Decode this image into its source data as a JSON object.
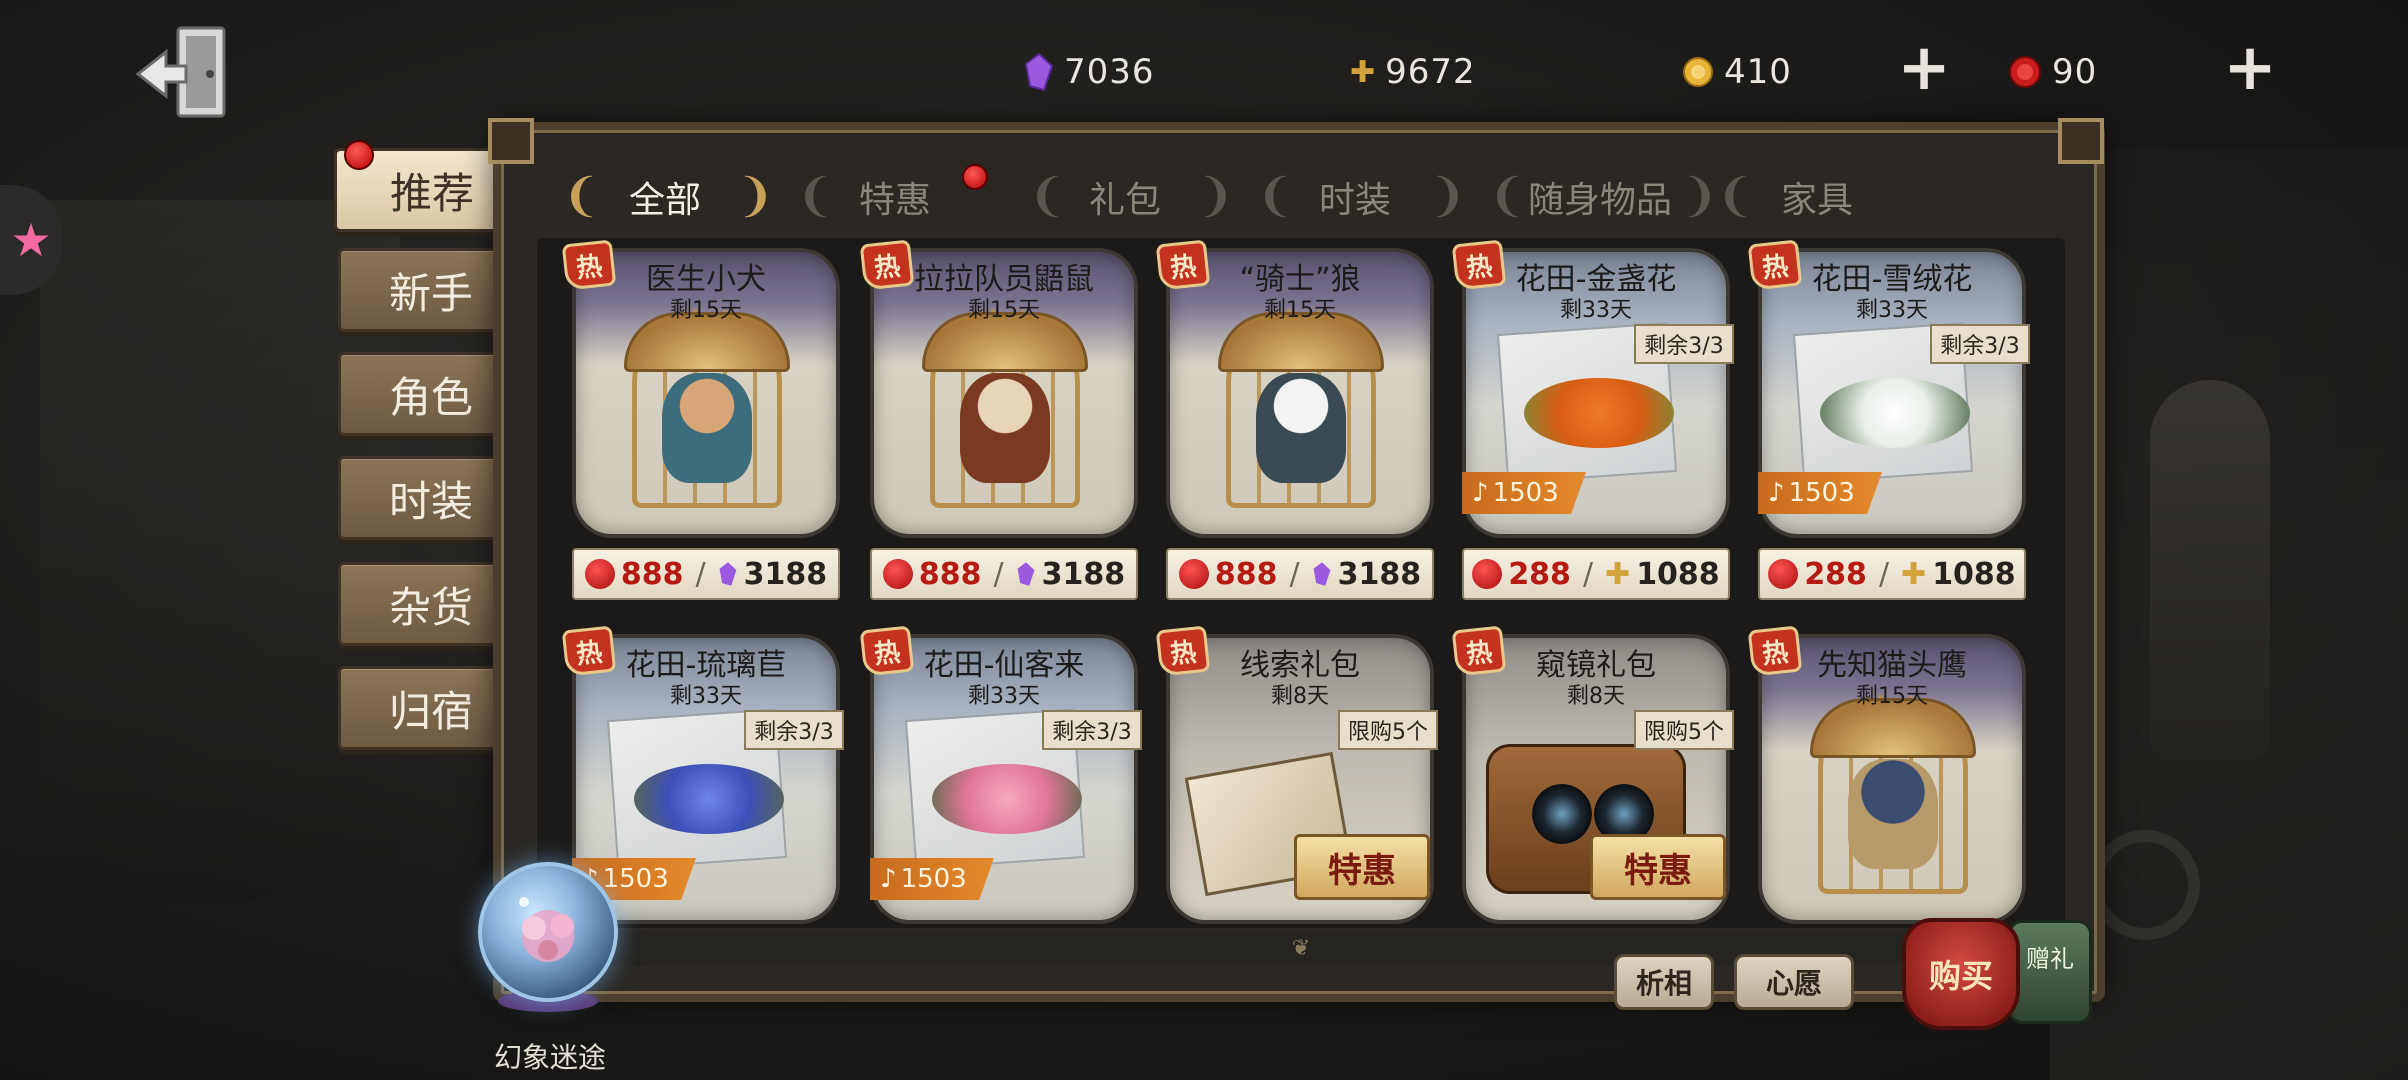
{
  "currencies": [
    {
      "icon": "purple-gem-icon",
      "value": "7036"
    },
    {
      "icon": "puzzle-piece-icon",
      "value": "9672"
    },
    {
      "icon": "gold-coin-icon",
      "value": "410"
    },
    {
      "icon": "red-seal-icon",
      "value": "90"
    }
  ],
  "sidebar": {
    "items": [
      {
        "label": "推荐"
      },
      {
        "label": "新手"
      },
      {
        "label": "角色"
      },
      {
        "label": "时装"
      },
      {
        "label": "杂货"
      },
      {
        "label": "归宿"
      }
    ]
  },
  "tabs": [
    {
      "label": "全部"
    },
    {
      "label": "特惠"
    },
    {
      "label": "礼包"
    },
    {
      "label": "时装"
    },
    {
      "label": "随身物品"
    },
    {
      "label": "家具"
    }
  ],
  "hot_label": "热",
  "items": [
    {
      "name": "医生小犬",
      "sub": "剩15天",
      "price_red": "888",
      "price_alt": "3188"
    },
    {
      "name": "拉拉队员鼯鼠",
      "sub": "剩15天",
      "price_red": "888",
      "price_alt": "3188"
    },
    {
      "name": "“骑士”狼",
      "sub": "剩15天",
      "price_red": "888",
      "price_alt": "3188"
    },
    {
      "name": "花田-金盏花",
      "sub": "剩33天",
      "remaining": "剩余3/3",
      "notes": "1503",
      "price_red": "288",
      "price_alt": "1088"
    },
    {
      "name": "花田-雪绒花",
      "sub": "剩33天",
      "remaining": "剩余3/3",
      "notes": "1503",
      "price_red": "288",
      "price_alt": "1088"
    },
    {
      "name": "花田-琉璃苣",
      "sub": "剩33天",
      "remaining": "剩余3/3",
      "notes": "1503"
    },
    {
      "name": "花田-仙客来",
      "sub": "剩33天",
      "remaining": "剩余3/3",
      "notes": "1503"
    },
    {
      "name": "线索礼包",
      "sub": "剩8天",
      "limit": "限购5个",
      "sale": "特惠"
    },
    {
      "name": "窥镜礼包",
      "sub": "剩8天",
      "limit": "限购5个",
      "sale": "特惠"
    },
    {
      "name": "先知猫头鹰",
      "sub": "剩15天"
    }
  ],
  "bottom": {
    "try_on": "析相",
    "wish": "心愿",
    "buy": "购买",
    "gift": "赠礼"
  },
  "event": {
    "label": "幻象迷途"
  },
  "colors": {
    "accent_red": "#b51b12",
    "gold": "#c8a05a",
    "panel_border": "#4b3e2c"
  }
}
